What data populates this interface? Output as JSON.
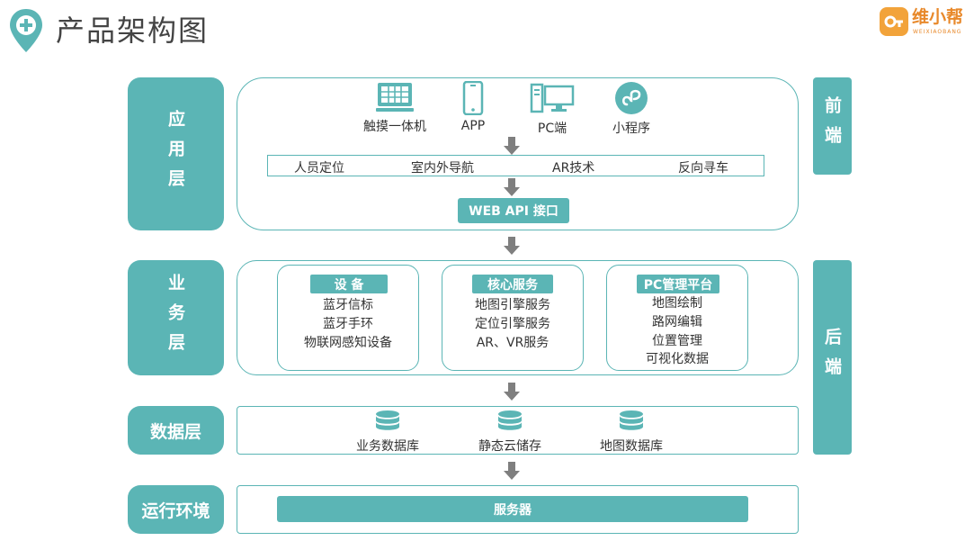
{
  "header": {
    "title": "产品架构图"
  },
  "brand": {
    "name": "维小帮",
    "subtitle": "WEIXIAOBANG"
  },
  "colors": {
    "accent": "#5bb5b5",
    "brand_orange": "#f2a33a",
    "arrow_gray": "#7f7f7f"
  },
  "layers": {
    "application": "应用层",
    "business": "业务层",
    "data": "数据层",
    "runtime": "运行环境"
  },
  "sides": {
    "frontend": "前端",
    "backend": "后端"
  },
  "application": {
    "clients": [
      {
        "label": "触摸一体机",
        "icon": "kiosk-icon"
      },
      {
        "label": "APP",
        "icon": "phone-icon"
      },
      {
        "label": "PC端",
        "icon": "pc-icon"
      },
      {
        "label": "小程序",
        "icon": "mini-program-icon"
      }
    ],
    "features": [
      "人员定位",
      "室内外导航",
      "AR技术",
      "反向寻车"
    ],
    "api_label": "WEB API 接口"
  },
  "business": {
    "groups": [
      {
        "title": "设 备",
        "items": [
          "蓝牙信标",
          "蓝牙手环",
          "物联网感知设备"
        ]
      },
      {
        "title": "核心服务",
        "items": [
          "地图引擎服务",
          "定位引擎服务",
          "AR、VR服务"
        ]
      },
      {
        "title": "PC管理平台",
        "items": [
          "地图绘制",
          "路网编辑",
          "位置管理",
          "可视化数据"
        ]
      }
    ]
  },
  "data_layer": {
    "stores": [
      "业务数据库",
      "静态云储存",
      "地图数据库"
    ]
  },
  "runtime": {
    "server_label": "服务器"
  }
}
